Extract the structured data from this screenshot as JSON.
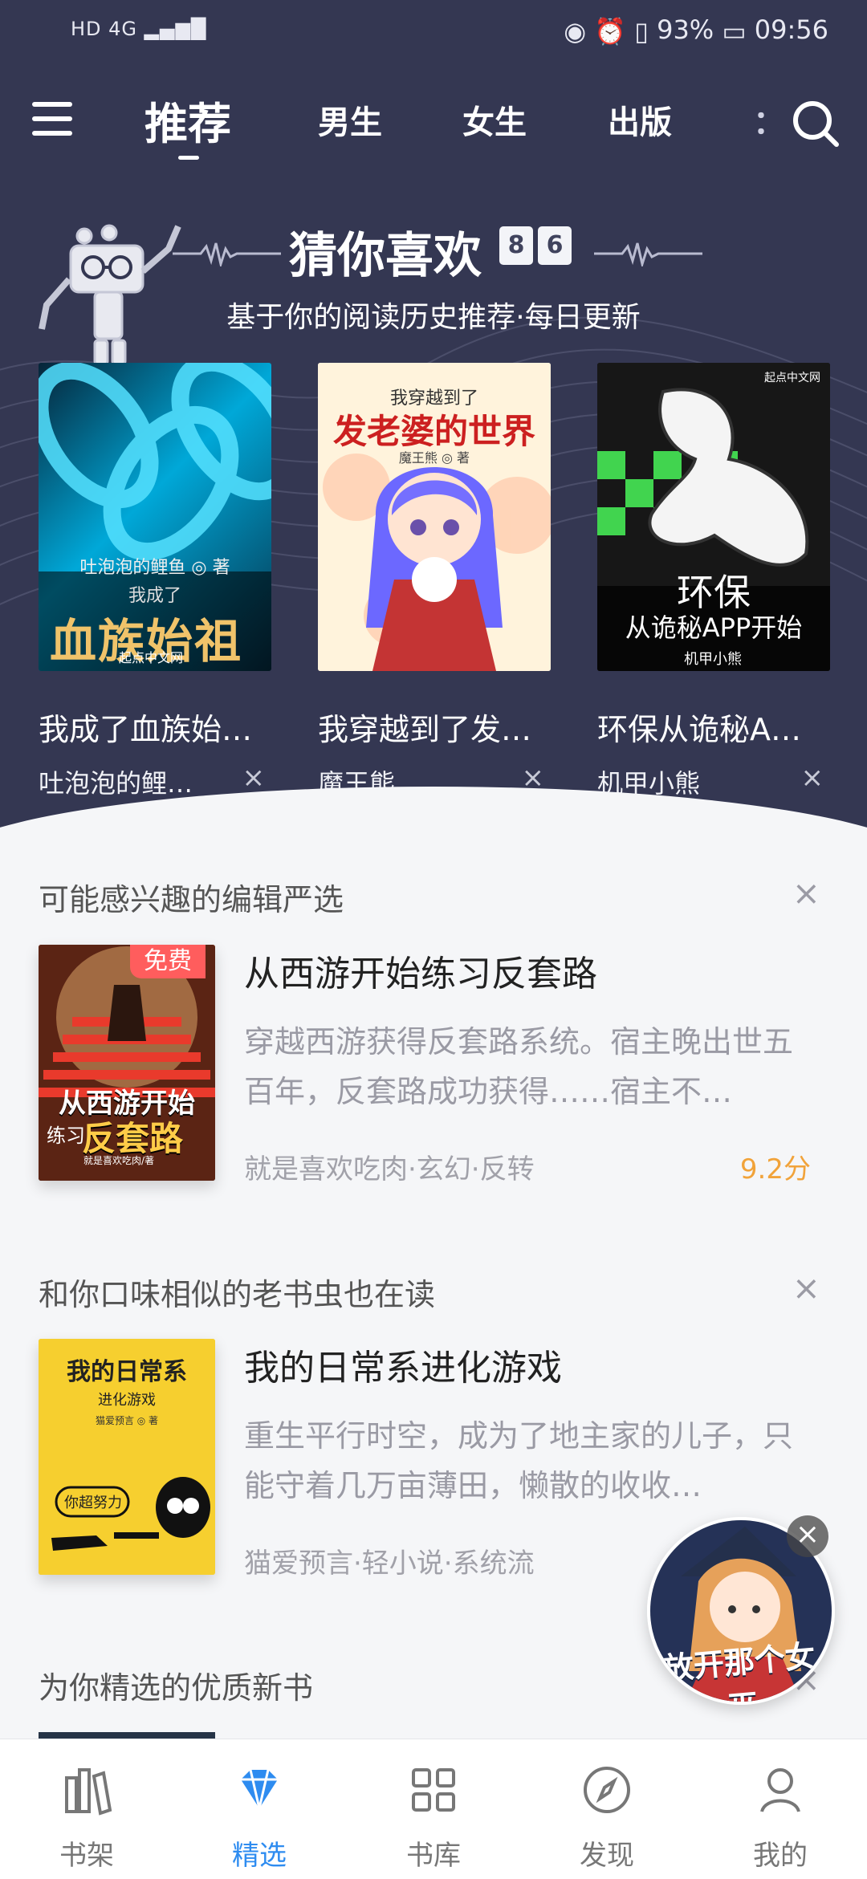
{
  "status": {
    "left_icons": "HD 4G ▂▄▆█",
    "battery": "93%",
    "time": "09:56"
  },
  "nav": {
    "tabs": [
      "推荐",
      "男生",
      "女生",
      "出版"
    ],
    "partial_tab": "：",
    "icons": [
      "menu-icon",
      "search-icon"
    ]
  },
  "hero": {
    "title": "猜你喜欢",
    "date_digits": [
      "8",
      "6"
    ],
    "subtitle": "基于你的阅读历史推荐·每日更新",
    "books": [
      {
        "title": "我成了血族始…",
        "author": "吐泡泡的鲤…",
        "cover_text": [
          "我成了",
          "血族始祖",
          "吐泡泡的鲤鱼 ◎ 著",
          "起点中文网"
        ]
      },
      {
        "title": "我穿越到了发…",
        "author": "魔王熊",
        "cover_text": [
          "我穿越到了",
          "发老婆的世界",
          "魔王熊 ◎ 著"
        ]
      },
      {
        "title": "环保从诡秘A…",
        "author": "机甲小熊",
        "cover_text": [
          "起点中文网",
          "环保",
          "从诡秘APP开始",
          "机甲小熊"
        ]
      }
    ]
  },
  "sections": [
    {
      "heading": "可能感兴趣的编辑严选",
      "close": "×",
      "book": {
        "title": "从西游开始练习反套路",
        "desc": "穿越西游获得反套路系统。宿主晚出世五百年，反套路成功获得……宿主不…",
        "meta": "就是喜欢吃肉·玄幻·反转",
        "score": "9.2分",
        "badge": "免费",
        "cover_text": [
          "从西游开始",
          "练习",
          "反套路",
          "就是喜欢吃肉/著"
        ]
      }
    },
    {
      "heading": "和你口味相似的老书虫也在读",
      "close": "×",
      "book": {
        "title": "我的日常系进化游戏",
        "desc": "重生平行时空，成为了地主家的儿子，只能守着几万亩薄田，懒散的收收…",
        "meta": "猫爱预言·轻小说·系统流",
        "cover_text": [
          "我的日常系",
          "进化游戏",
          "猫爱预言 ◎ 著",
          "你超努力"
        ]
      }
    },
    {
      "heading": "为你精选的优质新书",
      "close": "×"
    }
  ],
  "floating": {
    "close": "×",
    "text": "放开那个女巫"
  },
  "bottom_nav": [
    {
      "label": "书架",
      "icon": "bookshelf-icon"
    },
    {
      "label": "精选",
      "icon": "diamond-icon"
    },
    {
      "label": "书库",
      "icon": "grid-icon"
    },
    {
      "label": "发现",
      "icon": "compass-icon"
    },
    {
      "label": "我的",
      "icon": "user-icon"
    }
  ],
  "colors": {
    "hero": "#343752",
    "active": "#2e8cf0",
    "score": "#f1a33a",
    "badge": "#ff5d5d"
  }
}
